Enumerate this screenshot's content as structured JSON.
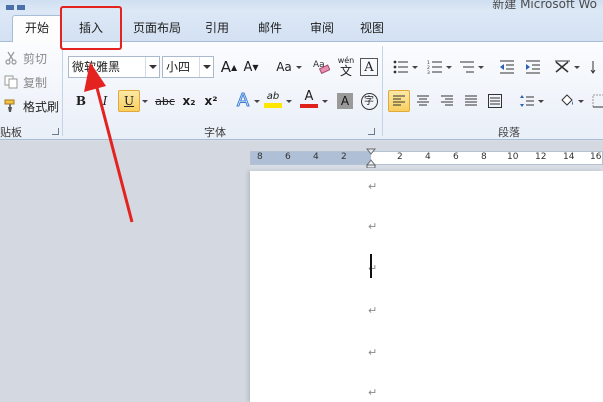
{
  "window": {
    "title": "新建 Microsoft Wo"
  },
  "tabs": [
    {
      "label": "开始",
      "active": true
    },
    {
      "label": "插入",
      "active": false
    },
    {
      "label": "页面布局",
      "active": false
    },
    {
      "label": "引用",
      "active": false
    },
    {
      "label": "邮件",
      "active": false
    },
    {
      "label": "审阅",
      "active": false
    },
    {
      "label": "视图",
      "active": false
    }
  ],
  "clipboard": {
    "cut": "剪切",
    "copy": "复制",
    "format_painter": "格式刷",
    "group_label": "贴板"
  },
  "font": {
    "family": "微软雅黑",
    "size": "小四",
    "grow": "A",
    "shrink": "A",
    "change_case": "Aa",
    "clear_format": "Aa",
    "phonetic": "wén",
    "phonetic_char": "文",
    "border_char": "A",
    "bold": "B",
    "italic": "I",
    "underline": "U",
    "strike": "abc",
    "subscript": "x₂",
    "superscript": "x²",
    "effect": "A",
    "highlight": "ab",
    "color": "A",
    "shade": "A",
    "enclose": "字",
    "group_label": "字体"
  },
  "paragraph": {
    "group_label": "段落"
  },
  "ruler": {
    "labels": [
      "8",
      "6",
      "4",
      "2",
      "2",
      "4",
      "6",
      "8",
      "10",
      "12",
      "14",
      "16"
    ]
  },
  "document": {
    "paragraph_mark": "↵"
  },
  "colors": {
    "accent_red": "#e4221f",
    "highlight_yellow": "#ffe600",
    "font_red": "#e0201b"
  }
}
